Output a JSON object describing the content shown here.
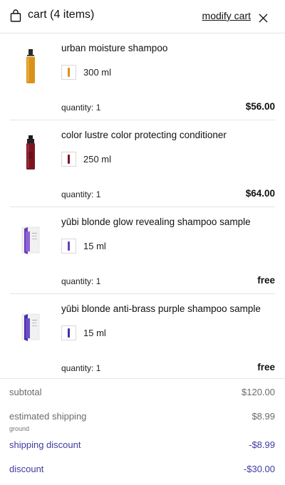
{
  "header": {
    "title": "cart (4 items)",
    "modify_label": "modify cart"
  },
  "icons": {
    "bag": "shopping-bag-icon",
    "close": "close-icon"
  },
  "items": [
    {
      "name": "urban moisture shampoo",
      "size": "300 ml",
      "quantity": "quantity: 1",
      "price": "$56.00",
      "color": "#d9921a"
    },
    {
      "name": "color lustre color protecting conditioner",
      "size": "250 ml",
      "quantity": "quantity: 1",
      "price": "$64.00",
      "color": "#7a1522"
    },
    {
      "name": "yūbi blonde glow revealing shampoo sample",
      "size": "15 ml",
      "quantity": "quantity: 1",
      "price": "free",
      "color": "#6a3fb8"
    },
    {
      "name": "yūbi blonde anti-brass purple shampoo sample",
      "size": "15 ml",
      "quantity": "quantity: 1",
      "price": "free",
      "color": "#4a2fa6"
    }
  ],
  "summary": {
    "subtotal_label": "subtotal",
    "subtotal_value": "$120.00",
    "shipping_label": "estimated shipping",
    "shipping_method": "ground",
    "shipping_value": "$8.99",
    "shipping_discount_label": "shipping discount",
    "shipping_discount_value": "-$8.99",
    "discount_label": "discount",
    "discount_value": "-$30.00"
  },
  "colors": {
    "accent": "#3f3aa0",
    "muted": "#6b6b6b",
    "divider": "#e4e4e4"
  }
}
